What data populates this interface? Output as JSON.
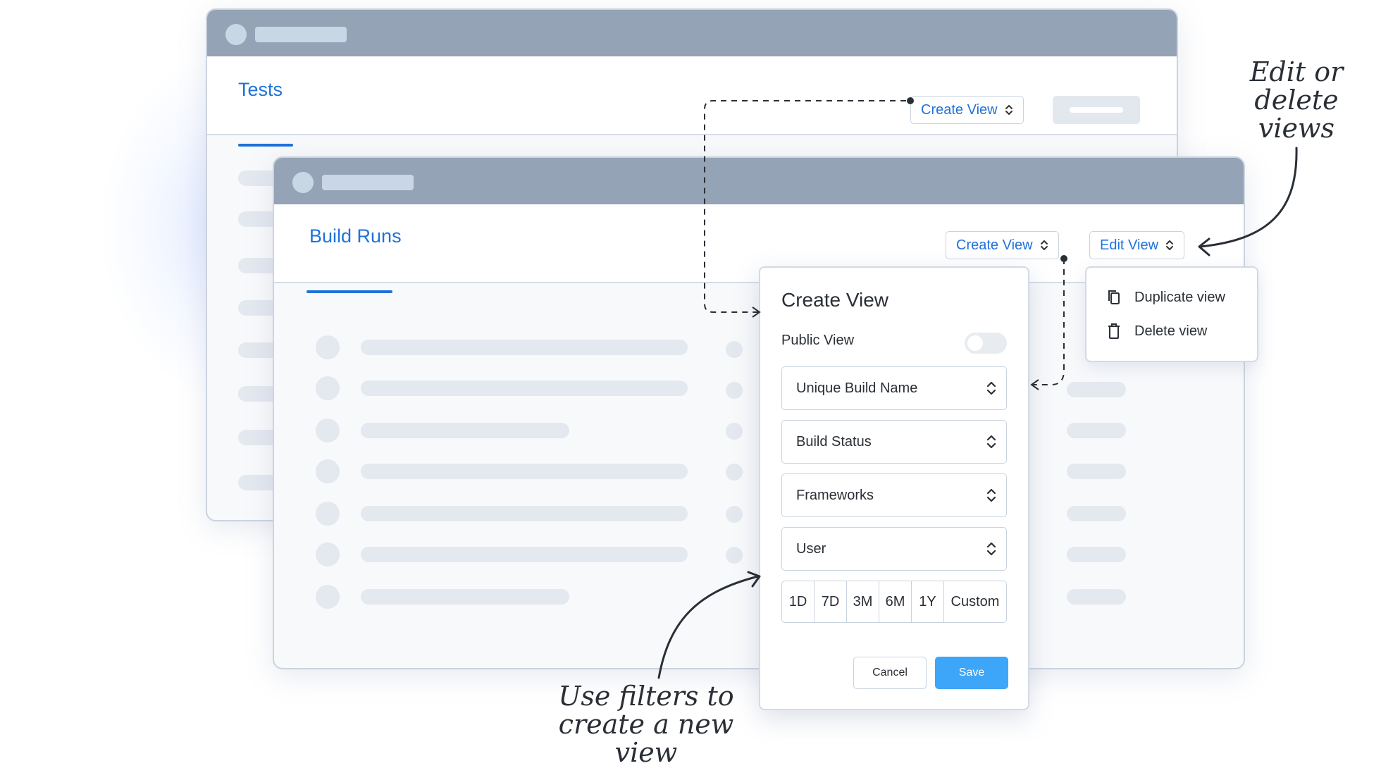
{
  "back_window": {
    "tab_title": "Tests",
    "create_view_label": "Create View"
  },
  "front_window": {
    "tab_title": "Build Runs",
    "create_view_label": "Create View",
    "edit_view_label": "Edit View"
  },
  "edit_menu": {
    "items": [
      {
        "label": "Duplicate view",
        "icon": "duplicate-icon"
      },
      {
        "label": "Delete view",
        "icon": "trash-icon"
      }
    ]
  },
  "create_view_modal": {
    "title": "Create View",
    "public_view_label": "Public View",
    "public_view_enabled": false,
    "filters": [
      "Unique Build Name",
      "Build Status",
      "Frameworks",
      "User"
    ],
    "time_ranges": [
      "1D",
      "7D",
      "3M",
      "6M",
      "1Y",
      "Custom"
    ],
    "cancel_label": "Cancel",
    "save_label": "Save"
  },
  "annotations": {
    "edit_or_delete": [
      "Edit or",
      "delete",
      "views"
    ],
    "use_filters": [
      "Use filters to",
      "create a new view"
    ]
  },
  "colors": {
    "accent": "#1f72d9",
    "titlebar": "#94a3b5",
    "save_button": "#3ea6f8"
  }
}
